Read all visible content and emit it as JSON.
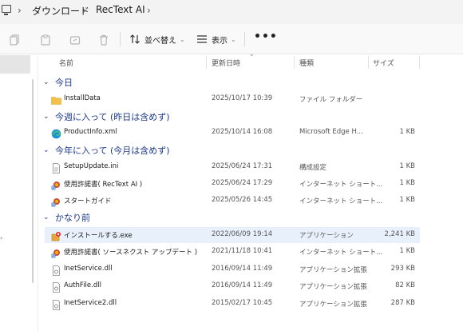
{
  "breadcrumb": {
    "items": [
      "ダウンロード",
      "RecText AI"
    ]
  },
  "toolbar": {
    "sort_label": "並べ替え",
    "view_label": "表示",
    "more_label": "•••"
  },
  "columns": {
    "name": "名前",
    "date": "更新日時",
    "type": "種類",
    "size": "サイズ"
  },
  "groups": [
    {
      "label": "今日",
      "rows": [
        {
          "name": "InstallData",
          "date": "2025/10/17 10:39",
          "type": "ファイル フォルダー",
          "size": "",
          "icon": "folder-icon"
        }
      ]
    },
    {
      "label": "今週に入って (昨日は含めず)",
      "rows": [
        {
          "name": "ProductInfo.xml",
          "date": "2025/10/14 16:08",
          "type": "Microsoft Edge H...",
          "size": "1 KB",
          "icon": "edge-icon"
        }
      ]
    },
    {
      "label": "今年に入って (今月は含めず)",
      "rows": [
        {
          "name": "SetupUpdate.ini",
          "date": "2025/06/24 17:31",
          "type": "構成設定",
          "size": "1 KB",
          "icon": "ini-file-icon"
        },
        {
          "name": "使用許諾書( RecText AI )",
          "date": "2025/06/24 17:29",
          "type": "インターネット ショート...",
          "size": "1 KB",
          "icon": "shortcut-icon"
        },
        {
          "name": "スタートガイド",
          "date": "2025/05/26 14:45",
          "type": "インターネット ショート...",
          "size": "1 KB",
          "icon": "shortcut-icon"
        }
      ]
    },
    {
      "label": "かなり前",
      "rows": [
        {
          "name": "インストールする.exe",
          "date": "2022/06/09 19:14",
          "type": "アプリケーション",
          "size": "2,241 KB",
          "icon": "installer-icon"
        },
        {
          "name": "使用許諾書( ソースネクスト アップデート )",
          "date": "2021/11/18 10:41",
          "type": "インターネット ショート...",
          "size": "1 KB",
          "icon": "shortcut-icon"
        },
        {
          "name": "InetService.dll",
          "date": "2016/09/14 11:49",
          "type": "アプリケーション拡張",
          "size": "293 KB",
          "icon": "dll-file-icon"
        },
        {
          "name": "AuthFile.dll",
          "date": "2016/09/14 11:49",
          "type": "アプリケーション拡張",
          "size": "82 KB",
          "icon": "dll-file-icon"
        },
        {
          "name": "InetService2.dll",
          "date": "2015/02/17 10:45",
          "type": "アプリケーション拡張",
          "size": "287 KB",
          "icon": "dll-file-icon"
        }
      ]
    }
  ],
  "colors": {
    "group_text": "#1d3a8a",
    "selected_row": "#e8f1fb",
    "folder": "#f0c04a"
  }
}
